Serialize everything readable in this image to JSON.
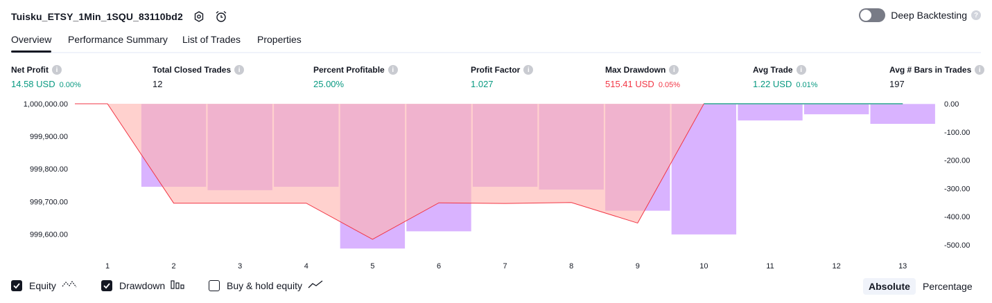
{
  "header": {
    "strategy_name": "Tuisku_ETSY_1Min_1SQU_83110bd2",
    "icons": [
      "settings-icon",
      "alarm-add-icon"
    ],
    "deep_backtesting_label": "Deep Backtesting",
    "deep_backtesting_enabled": false,
    "help_glyph": "?"
  },
  "tabs": [
    {
      "label": "Overview",
      "active": true
    },
    {
      "label": "Performance Summary",
      "active": false
    },
    {
      "label": "List of Trades",
      "active": false
    },
    {
      "label": "Properties",
      "active": false
    }
  ],
  "metrics": {
    "net_profit": {
      "label": "Net Profit",
      "value": "14.58 USD",
      "pct": "0.00%"
    },
    "total_closed_trades": {
      "label": "Total Closed Trades",
      "value": "12"
    },
    "percent_profitable": {
      "label": "Percent Profitable",
      "value": "25.00%"
    },
    "profit_factor": {
      "label": "Profit Factor",
      "value": "1.027"
    },
    "max_drawdown": {
      "label": "Max Drawdown",
      "value": "515.41 USD",
      "pct": "0.05%"
    },
    "avg_trade": {
      "label": "Avg Trade",
      "value": "1.22 USD",
      "pct": "0.01%"
    },
    "avg_bars": {
      "label": "Avg # Bars in Trades",
      "value": "197"
    },
    "info_glyph": "i"
  },
  "colors": {
    "profit": "#089981",
    "loss": "#f23645",
    "drawdown_bar": "#d9b3ff",
    "equity_line": "#f23645",
    "equity_fill": "#ffb3ae"
  },
  "chart_data": {
    "type": "area",
    "x": [
      "1",
      "2",
      "3",
      "4",
      "5",
      "6",
      "7",
      "8",
      "9",
      "10",
      "11",
      "12",
      "13"
    ],
    "left_axis": {
      "ticks": [
        "1,000,000.00",
        "999,900.00",
        "999,800.00",
        "999,700.00",
        "999,600.00"
      ],
      "ylim": [
        999550,
        1000000
      ]
    },
    "right_axis": {
      "ticks": [
        "0.00",
        "-100.00",
        "-200.00",
        "-300.00",
        "-400.00",
        "-500.00"
      ],
      "ylim": [
        -520,
        0
      ]
    },
    "series": [
      {
        "name": "Equity",
        "axis": "left",
        "values": [
          1000000,
          999695,
          999695,
          999695,
          999584,
          999696,
          999694,
          999697,
          999634,
          1000000,
          1000000,
          1000000,
          1000000
        ]
      },
      {
        "name": "Drawdown",
        "axis": "right",
        "values": [
          0,
          -295,
          -307,
          -295,
          -514,
          -453,
          -295,
          -305,
          -380,
          -464,
          -60,
          -38,
          -72
        ]
      }
    ]
  },
  "legend": [
    {
      "label": "Equity",
      "checked": true,
      "icon": "equity-line-icon"
    },
    {
      "label": "Drawdown",
      "checked": true,
      "icon": "drawdown-bars-icon"
    },
    {
      "label": "Buy & hold equity",
      "checked": false,
      "icon": "buy-hold-line-icon"
    }
  ],
  "modes": [
    {
      "label": "Absolute",
      "active": true
    },
    {
      "label": "Percentage",
      "active": false
    }
  ]
}
